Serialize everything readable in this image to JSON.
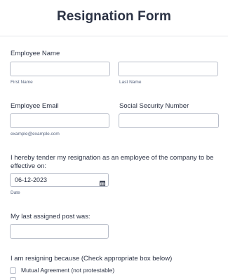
{
  "form": {
    "title": "Resignation Form"
  },
  "employee_name": {
    "label": "Employee Name",
    "first_sublabel": "First Name",
    "last_sublabel": "Last Name",
    "first_value": "",
    "last_value": ""
  },
  "employee_email": {
    "label": "Employee Email",
    "sublabel": "example@example.com",
    "value": ""
  },
  "ssn": {
    "label": "Social Security Number",
    "value": ""
  },
  "tender": {
    "label": "I hereby tender my resignation as an employee of the company to be effective on:",
    "date_value": "06-12-2023",
    "date_sublabel": "Date",
    "calendar_icon": "calendar-icon"
  },
  "last_post": {
    "label": "My last assigned post was:",
    "value": ""
  },
  "reasons": {
    "label": "I am resigning because (Check appropriate box below)",
    "options": [
      {
        "label": "Mutual Agreement (not protestable)",
        "checked": false
      }
    ]
  },
  "colors": {
    "text": "#2c3345",
    "sublabel": "#57647e",
    "border": "#b8bdc9",
    "divider": "#e3e5ea"
  }
}
